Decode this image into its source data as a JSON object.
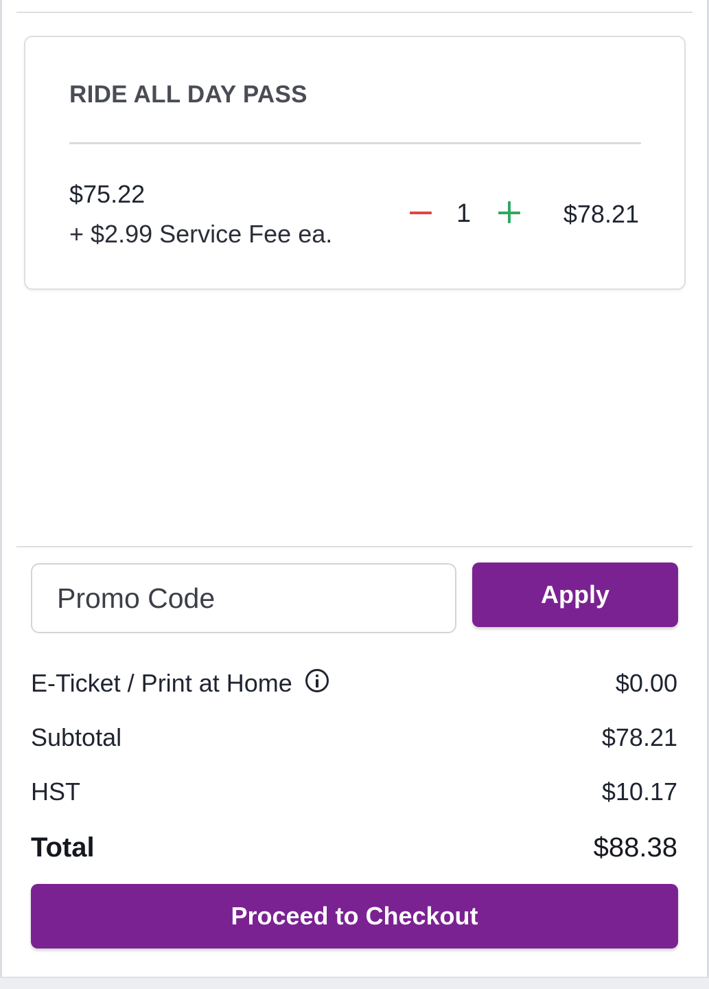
{
  "ticket": {
    "title": "RIDE ALL DAY PASS",
    "unit_price": "$75.22",
    "service_fee": "+ $2.99 Service Fee ea.",
    "quantity": "1",
    "line_total": "$78.21",
    "minus_icon": "minus-icon",
    "plus_icon": "plus-icon"
  },
  "promo": {
    "placeholder": "Promo Code",
    "apply_label": "Apply"
  },
  "summary": {
    "eticket_label": "E-Ticket / Print at Home",
    "eticket_value": "$0.00",
    "subtotal_label": "Subtotal",
    "subtotal_value": "$78.21",
    "hst_label": "HST",
    "hst_value": "$10.17",
    "total_label": "Total",
    "total_value": "$88.38"
  },
  "checkout": {
    "label": "Proceed to Checkout"
  },
  "colors": {
    "accent": "#7b2292",
    "minus": "#e0453f",
    "plus": "#2ea861"
  }
}
